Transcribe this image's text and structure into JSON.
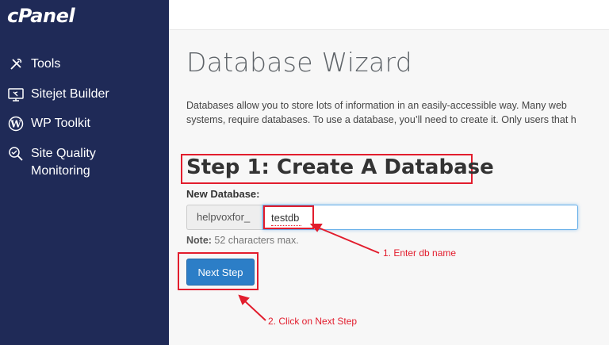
{
  "sidebar": {
    "logo": "cPanel",
    "items": [
      {
        "label": "Tools",
        "icon": "tools-icon"
      },
      {
        "label": "Sitejet Builder",
        "icon": "sitejet-icon"
      },
      {
        "label": "WP Toolkit",
        "icon": "wordpress-icon"
      },
      {
        "label": "Site Quality Monitoring",
        "line1": "Site Quality",
        "line2": "Monitoring",
        "icon": "search-check-icon"
      }
    ]
  },
  "main": {
    "title": "Database Wizard",
    "description_line1": "Databases allow you to store lots of information in an easily-accessible way. Many web",
    "description_line2": "systems, require databases. To use a database, you’ll need to create it. Only users that h",
    "step_title": "Step 1: Create A Database",
    "field_label": "New Database:",
    "prefix": "helpvoxfor_",
    "input_value": "testdb",
    "note_label": "Note:",
    "note_text": " 52 characters max.",
    "next_button": "Next Step"
  },
  "annotations": {
    "first": "1. Enter db name",
    "second": "2. Click on Next Step",
    "color": "#e21d2d"
  },
  "colors": {
    "sidebar_bg": "#1f2a57",
    "button_bg": "#2c7ec7",
    "highlight": "#e21d2d"
  }
}
